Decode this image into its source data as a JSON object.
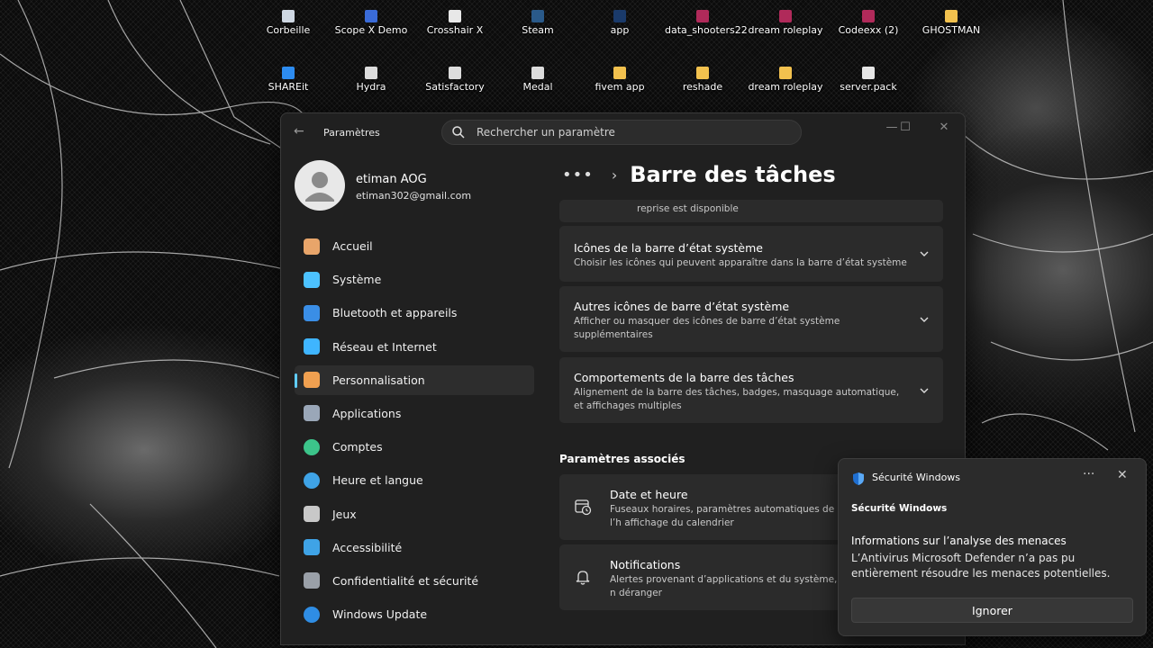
{
  "desktop": {
    "icons": [
      {
        "label": "Corbeille",
        "icon": "recycle-bin-icon",
        "color": "#cfd8e3"
      },
      {
        "label": "Scope X Demo",
        "icon": "app-icon",
        "color": "#3a6bd8"
      },
      {
        "label": "Crosshair X",
        "icon": "crosshair-icon",
        "color": "#e8e8e8"
      },
      {
        "label": "Steam",
        "icon": "steam-icon",
        "color": "#2a5a8a"
      },
      {
        "label": "app",
        "icon": "app-icon",
        "color": "#1a3a6a"
      },
      {
        "label": "data_shooters22",
        "icon": "archive-icon",
        "color": "#b02a5a"
      },
      {
        "label": "dream roleplay",
        "icon": "archive-icon",
        "color": "#b02a5a"
      },
      {
        "label": "Codeexx (2)",
        "icon": "archive-icon",
        "color": "#b02a5a"
      },
      {
        "label": "GHOSTMAN",
        "icon": "folder-icon",
        "color": "#f2c14e"
      },
      {
        "label": "SHAREit",
        "icon": "shareit-icon",
        "color": "#2d8cf0"
      },
      {
        "label": "Hydra",
        "icon": "app-icon",
        "color": "#dcdcdc"
      },
      {
        "label": "Satisfactory",
        "icon": "app-icon",
        "color": "#dcdcdc"
      },
      {
        "label": "Medal",
        "icon": "app-icon",
        "color": "#dcdcdc"
      },
      {
        "label": "fivem app",
        "icon": "folder-icon",
        "color": "#f2c14e"
      },
      {
        "label": "reshade",
        "icon": "folder-icon",
        "color": "#f2c14e"
      },
      {
        "label": "dream roleplay",
        "icon": "folder-icon",
        "color": "#f2c14e"
      },
      {
        "label": "server.pack",
        "icon": "file-icon",
        "color": "#e6e6e6"
      }
    ]
  },
  "settings": {
    "title": "Paramètres",
    "search_placeholder": "Rechercher un paramètre",
    "user": {
      "name": "etiman AOG",
      "email": "etiman302@gmail.com"
    },
    "nav": [
      {
        "label": "Accueil",
        "icon": "home-icon",
        "color": "#e8a56a"
      },
      {
        "label": "Système",
        "icon": "system-icon",
        "color": "#4cc2ff"
      },
      {
        "label": "Bluetooth et appareils",
        "icon": "bluetooth-icon",
        "color": "#3a8ee6"
      },
      {
        "label": "Réseau et Internet",
        "icon": "wifi-icon",
        "color": "#3fb5ff"
      },
      {
        "label": "Personnalisation",
        "icon": "brush-icon",
        "color": "#f0a050",
        "active": true
      },
      {
        "label": "Applications",
        "icon": "apps-icon",
        "color": "#9aa7b8"
      },
      {
        "label": "Comptes",
        "icon": "person-icon",
        "color": "#3cc48a"
      },
      {
        "label": "Heure et langue",
        "icon": "globe-clock-icon",
        "color": "#3fa3e6"
      },
      {
        "label": "Jeux",
        "icon": "gamepad-icon",
        "color": "#c8c8c8"
      },
      {
        "label": "Accessibilité",
        "icon": "accessibility-icon",
        "color": "#3fa3e6"
      },
      {
        "label": "Confidentialité et sécurité",
        "icon": "shield-icon",
        "color": "#9aa0a8"
      },
      {
        "label": "Windows Update",
        "icon": "update-icon",
        "color": "#2f8de4"
      }
    ],
    "breadcrumb": {
      "more": "•••",
      "sep": "›",
      "title": "Barre des tâches"
    },
    "partial_text": "reprise est disponible",
    "cards": [
      {
        "title": "Icônes de la barre d’état système",
        "desc": "Choisir les icônes qui peuvent apparaître dans la barre d’état système"
      },
      {
        "title": "Autres icônes de barre d’état système",
        "desc": "Afficher ou masquer des icônes de barre d’état système supplémentaires"
      },
      {
        "title": "Comportements de la barre des tâches",
        "desc": "Alignement de la barre des tâches, badges, masquage automatique, et affichages multiples"
      }
    ],
    "related_heading": "Paramètres associés",
    "related": [
      {
        "title": "Date et heure",
        "desc": "Fuseaux horaires, paramètres automatiques de l’h affichage du calendrier",
        "icon": "calendar-clock-icon"
      },
      {
        "title": "Notifications",
        "desc": "Alertes provenant d’applications et du système, n déranger",
        "icon": "bell-icon"
      }
    ]
  },
  "toast": {
    "app": "Sécurité Windows",
    "more": "···",
    "close": "✕",
    "header": "Sécurité Windows",
    "title": "Informations sur l’analyse des menaces",
    "body": "L’Antivirus Microsoft Defender n’a pas pu entièrement résoudre les menaces potentielles.",
    "button": "Ignorer"
  },
  "colors": {
    "accent": "#60cdff",
    "window_bg": "#202020",
    "card_bg": "#2b2b2b"
  }
}
